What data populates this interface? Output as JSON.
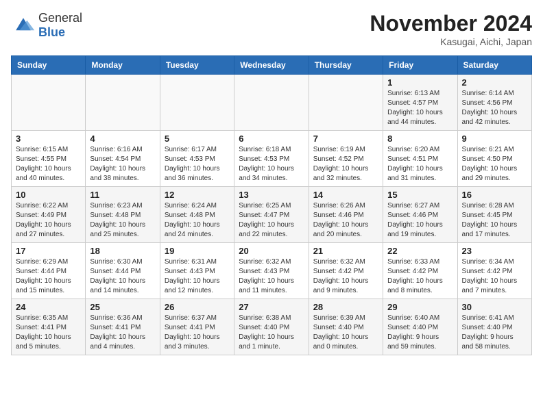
{
  "header": {
    "logo_general": "General",
    "logo_blue": "Blue",
    "month": "November 2024",
    "location": "Kasugai, Aichi, Japan"
  },
  "weekdays": [
    "Sunday",
    "Monday",
    "Tuesday",
    "Wednesday",
    "Thursday",
    "Friday",
    "Saturday"
  ],
  "weeks": [
    [
      {
        "day": "",
        "info": ""
      },
      {
        "day": "",
        "info": ""
      },
      {
        "day": "",
        "info": ""
      },
      {
        "day": "",
        "info": ""
      },
      {
        "day": "",
        "info": ""
      },
      {
        "day": "1",
        "info": "Sunrise: 6:13 AM\nSunset: 4:57 PM\nDaylight: 10 hours\nand 44 minutes."
      },
      {
        "day": "2",
        "info": "Sunrise: 6:14 AM\nSunset: 4:56 PM\nDaylight: 10 hours\nand 42 minutes."
      }
    ],
    [
      {
        "day": "3",
        "info": "Sunrise: 6:15 AM\nSunset: 4:55 PM\nDaylight: 10 hours\nand 40 minutes."
      },
      {
        "day": "4",
        "info": "Sunrise: 6:16 AM\nSunset: 4:54 PM\nDaylight: 10 hours\nand 38 minutes."
      },
      {
        "day": "5",
        "info": "Sunrise: 6:17 AM\nSunset: 4:53 PM\nDaylight: 10 hours\nand 36 minutes."
      },
      {
        "day": "6",
        "info": "Sunrise: 6:18 AM\nSunset: 4:53 PM\nDaylight: 10 hours\nand 34 minutes."
      },
      {
        "day": "7",
        "info": "Sunrise: 6:19 AM\nSunset: 4:52 PM\nDaylight: 10 hours\nand 32 minutes."
      },
      {
        "day": "8",
        "info": "Sunrise: 6:20 AM\nSunset: 4:51 PM\nDaylight: 10 hours\nand 31 minutes."
      },
      {
        "day": "9",
        "info": "Sunrise: 6:21 AM\nSunset: 4:50 PM\nDaylight: 10 hours\nand 29 minutes."
      }
    ],
    [
      {
        "day": "10",
        "info": "Sunrise: 6:22 AM\nSunset: 4:49 PM\nDaylight: 10 hours\nand 27 minutes."
      },
      {
        "day": "11",
        "info": "Sunrise: 6:23 AM\nSunset: 4:48 PM\nDaylight: 10 hours\nand 25 minutes."
      },
      {
        "day": "12",
        "info": "Sunrise: 6:24 AM\nSunset: 4:48 PM\nDaylight: 10 hours\nand 24 minutes."
      },
      {
        "day": "13",
        "info": "Sunrise: 6:25 AM\nSunset: 4:47 PM\nDaylight: 10 hours\nand 22 minutes."
      },
      {
        "day": "14",
        "info": "Sunrise: 6:26 AM\nSunset: 4:46 PM\nDaylight: 10 hours\nand 20 minutes."
      },
      {
        "day": "15",
        "info": "Sunrise: 6:27 AM\nSunset: 4:46 PM\nDaylight: 10 hours\nand 19 minutes."
      },
      {
        "day": "16",
        "info": "Sunrise: 6:28 AM\nSunset: 4:45 PM\nDaylight: 10 hours\nand 17 minutes."
      }
    ],
    [
      {
        "day": "17",
        "info": "Sunrise: 6:29 AM\nSunset: 4:44 PM\nDaylight: 10 hours\nand 15 minutes."
      },
      {
        "day": "18",
        "info": "Sunrise: 6:30 AM\nSunset: 4:44 PM\nDaylight: 10 hours\nand 14 minutes."
      },
      {
        "day": "19",
        "info": "Sunrise: 6:31 AM\nSunset: 4:43 PM\nDaylight: 10 hours\nand 12 minutes."
      },
      {
        "day": "20",
        "info": "Sunrise: 6:32 AM\nSunset: 4:43 PM\nDaylight: 10 hours\nand 11 minutes."
      },
      {
        "day": "21",
        "info": "Sunrise: 6:32 AM\nSunset: 4:42 PM\nDaylight: 10 hours\nand 9 minutes."
      },
      {
        "day": "22",
        "info": "Sunrise: 6:33 AM\nSunset: 4:42 PM\nDaylight: 10 hours\nand 8 minutes."
      },
      {
        "day": "23",
        "info": "Sunrise: 6:34 AM\nSunset: 4:42 PM\nDaylight: 10 hours\nand 7 minutes."
      }
    ],
    [
      {
        "day": "24",
        "info": "Sunrise: 6:35 AM\nSunset: 4:41 PM\nDaylight: 10 hours\nand 5 minutes."
      },
      {
        "day": "25",
        "info": "Sunrise: 6:36 AM\nSunset: 4:41 PM\nDaylight: 10 hours\nand 4 minutes."
      },
      {
        "day": "26",
        "info": "Sunrise: 6:37 AM\nSunset: 4:41 PM\nDaylight: 10 hours\nand 3 minutes."
      },
      {
        "day": "27",
        "info": "Sunrise: 6:38 AM\nSunset: 4:40 PM\nDaylight: 10 hours\nand 1 minute."
      },
      {
        "day": "28",
        "info": "Sunrise: 6:39 AM\nSunset: 4:40 PM\nDaylight: 10 hours\nand 0 minutes."
      },
      {
        "day": "29",
        "info": "Sunrise: 6:40 AM\nSunset: 4:40 PM\nDaylight: 9 hours\nand 59 minutes."
      },
      {
        "day": "30",
        "info": "Sunrise: 6:41 AM\nSunset: 4:40 PM\nDaylight: 9 hours\nand 58 minutes."
      }
    ]
  ]
}
